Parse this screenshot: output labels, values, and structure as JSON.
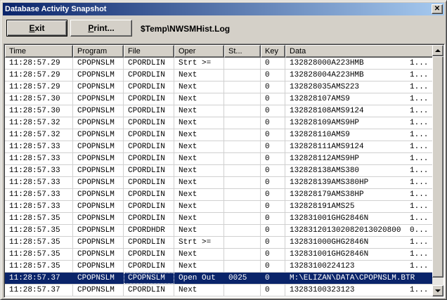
{
  "window": {
    "title": "Database Activity Snapshot",
    "close_glyph": "✕"
  },
  "toolbar": {
    "exit_mnemonic": "E",
    "exit_rest": "xit",
    "print_mnemonic": "P",
    "print_rest": "rint...",
    "log_path": "$Temp\\NWSMHist.Log"
  },
  "table": {
    "columns": [
      "Time",
      "Program",
      "File",
      "Oper",
      "St...",
      "Key",
      "Data"
    ],
    "rows": [
      {
        "time": "11:28:57.29",
        "program": "CPOPNSLM",
        "file": "CPORDLIN",
        "oper": "Strt >=",
        "st": "",
        "key": "0",
        "data": "132828000A223HMB",
        "more": "1..."
      },
      {
        "time": "11:28:57.29",
        "program": "CPOPNSLM",
        "file": "CPORDLIN",
        "oper": "Next",
        "st": "",
        "key": "0",
        "data": "132828004A223HMB",
        "more": "1..."
      },
      {
        "time": "11:28:57.29",
        "program": "CPOPNSLM",
        "file": "CPORDLIN",
        "oper": "Next",
        "st": "",
        "key": "0",
        "data": "132828035AMS223",
        "more": "1..."
      },
      {
        "time": "11:28:57.30",
        "program": "CPOPNSLM",
        "file": "CPORDLIN",
        "oper": "Next",
        "st": "",
        "key": "0",
        "data": "132828107AMS9",
        "more": "1..."
      },
      {
        "time": "11:28:57.30",
        "program": "CPOPNSLM",
        "file": "CPORDLIN",
        "oper": "Next",
        "st": "",
        "key": "0",
        "data": "132828108AMS9124",
        "more": "1..."
      },
      {
        "time": "11:28:57.32",
        "program": "CPOPNSLM",
        "file": "CPORDLIN",
        "oper": "Next",
        "st": "",
        "key": "0",
        "data": "132828109AMS9HP",
        "more": "1..."
      },
      {
        "time": "11:28:57.32",
        "program": "CPOPNSLM",
        "file": "CPORDLIN",
        "oper": "Next",
        "st": "",
        "key": "0",
        "data": "132828110AMS9",
        "more": "1..."
      },
      {
        "time": "11:28:57.33",
        "program": "CPOPNSLM",
        "file": "CPORDLIN",
        "oper": "Next",
        "st": "",
        "key": "0",
        "data": "132828111AMS9124",
        "more": "1..."
      },
      {
        "time": "11:28:57.33",
        "program": "CPOPNSLM",
        "file": "CPORDLIN",
        "oper": "Next",
        "st": "",
        "key": "0",
        "data": "132828112AMS9HP",
        "more": "1..."
      },
      {
        "time": "11:28:57.33",
        "program": "CPOPNSLM",
        "file": "CPORDLIN",
        "oper": "Next",
        "st": "",
        "key": "0",
        "data": "132828138AMS380",
        "more": "1..."
      },
      {
        "time": "11:28:57.33",
        "program": "CPOPNSLM",
        "file": "CPORDLIN",
        "oper": "Next",
        "st": "",
        "key": "0",
        "data": "132828139AMS380HP",
        "more": "1..."
      },
      {
        "time": "11:28:57.33",
        "program": "CPOPNSLM",
        "file": "CPORDLIN",
        "oper": "Next",
        "st": "",
        "key": "0",
        "data": "132828179AMS38HP",
        "more": "1..."
      },
      {
        "time": "11:28:57.33",
        "program": "CPOPNSLM",
        "file": "CPORDLIN",
        "oper": "Next",
        "st": "",
        "key": "0",
        "data": "132828191AMS25",
        "more": "1..."
      },
      {
        "time": "11:28:57.35",
        "program": "CPOPNSLM",
        "file": "CPORDLIN",
        "oper": "Next",
        "st": "",
        "key": "0",
        "data": "132831001GHG2846N",
        "more": "1..."
      },
      {
        "time": "11:28:57.35",
        "program": "CPOPNSLM",
        "file": "CPORDHDR",
        "oper": "Next",
        "st": "",
        "key": "0",
        "data": "132831201302082013020800",
        "more": "0..."
      },
      {
        "time": "11:28:57.35",
        "program": "CPOPNSLM",
        "file": "CPORDLIN",
        "oper": "Strt >=",
        "st": "",
        "key": "0",
        "data": "132831000GHG2846N",
        "more": "1..."
      },
      {
        "time": "11:28:57.35",
        "program": "CPOPNSLM",
        "file": "CPORDLIN",
        "oper": "Next",
        "st": "",
        "key": "0",
        "data": "132831001GHG2846N",
        "more": "1..."
      },
      {
        "time": "11:28:57.35",
        "program": "CPOPNSLM",
        "file": "CPORDLIN",
        "oper": "Next",
        "st": "",
        "key": "0",
        "data": "13283100224123",
        "more": "1..."
      },
      {
        "time": "11:28:57.37",
        "program": "CPOPNSLM",
        "file": "CPOPNSLM",
        "oper": "Open Out",
        "st": "0025",
        "key": "0",
        "data": "M:\\ELIZAN\\DATA\\CPOPNSLM.BTR",
        "more": "",
        "selected": true
      },
      {
        "time": "11:28:57.37",
        "program": "CPOPNSLM",
        "file": "CPORDLIN",
        "oper": "Next",
        "st": "",
        "key": "0",
        "data": "13283100323123",
        "more": "1..."
      }
    ]
  },
  "colors": {
    "face": "#d4d0c8",
    "title_bg": "#0a246a",
    "selection": "#0a246a"
  }
}
